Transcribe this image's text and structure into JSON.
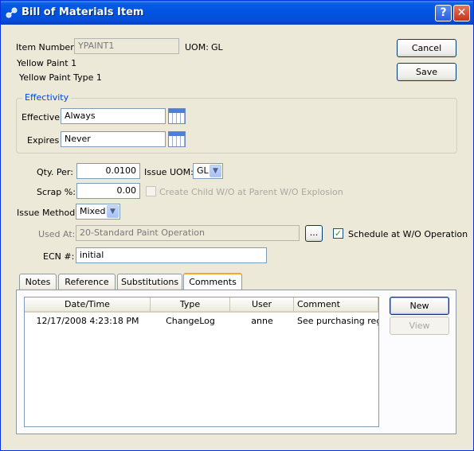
{
  "window": {
    "title": "Bill of Materials Item",
    "help_label": "?",
    "close_label": "✕"
  },
  "item": {
    "number_label": "Item Number:",
    "number_value": "YPAINT1",
    "uom_label": "UOM:",
    "uom_value": "GL",
    "description1": "Yellow Paint 1",
    "description2": "Yellow Paint Type 1"
  },
  "buttons": {
    "cancel": "Cancel",
    "save": "Save"
  },
  "effectivity": {
    "title": "Effectivity",
    "effective_label": "Effective",
    "effective_value": "Always",
    "expires_label": "Expires",
    "expires_value": "Never"
  },
  "details": {
    "qty_per_label": "Qty. Per:",
    "qty_per_value": "0.0100",
    "issue_uom_label": "Issue UOM:",
    "issue_uom_value": "GL",
    "scrap_label": "Scrap %:",
    "scrap_value": "0.00",
    "create_child_label": "Create Child W/O at Parent W/O Explosion",
    "create_child_checked": false,
    "issue_method_label": "Issue Method:",
    "issue_method_value": "Mixed",
    "used_at_label": "Used At:",
    "used_at_value": "20-Standard Paint Operation",
    "used_at_browse": "...",
    "schedule_label": "Schedule at W/O Operation",
    "schedule_checked": true,
    "ecn_label": "ECN #:",
    "ecn_value": "initial"
  },
  "tabs": [
    {
      "label": "Notes"
    },
    {
      "label": "Reference"
    },
    {
      "label": "Substitutions"
    },
    {
      "label": "Comments",
      "active": true
    }
  ],
  "comments": {
    "columns": [
      "Date/Time",
      "Type",
      "User",
      "Comment"
    ],
    "rows": [
      {
        "datetime": "12/17/2008 4:23:18 PM",
        "type": "ChangeLog",
        "user": "anne",
        "comment": "See purchasing reg..."
      }
    ],
    "new_label": "New",
    "view_label": "View"
  },
  "colors": {
    "titlebar": "#0054e3",
    "dialog_bg": "#ece9d8",
    "group_title": "#0046d5",
    "tab_highlight": "#f7a626"
  },
  "icons": {
    "title_icon": "bom-icon",
    "calendar": "calendar-icon",
    "dropdown": "chevron-down-icon",
    "check": "checkmark-icon"
  }
}
